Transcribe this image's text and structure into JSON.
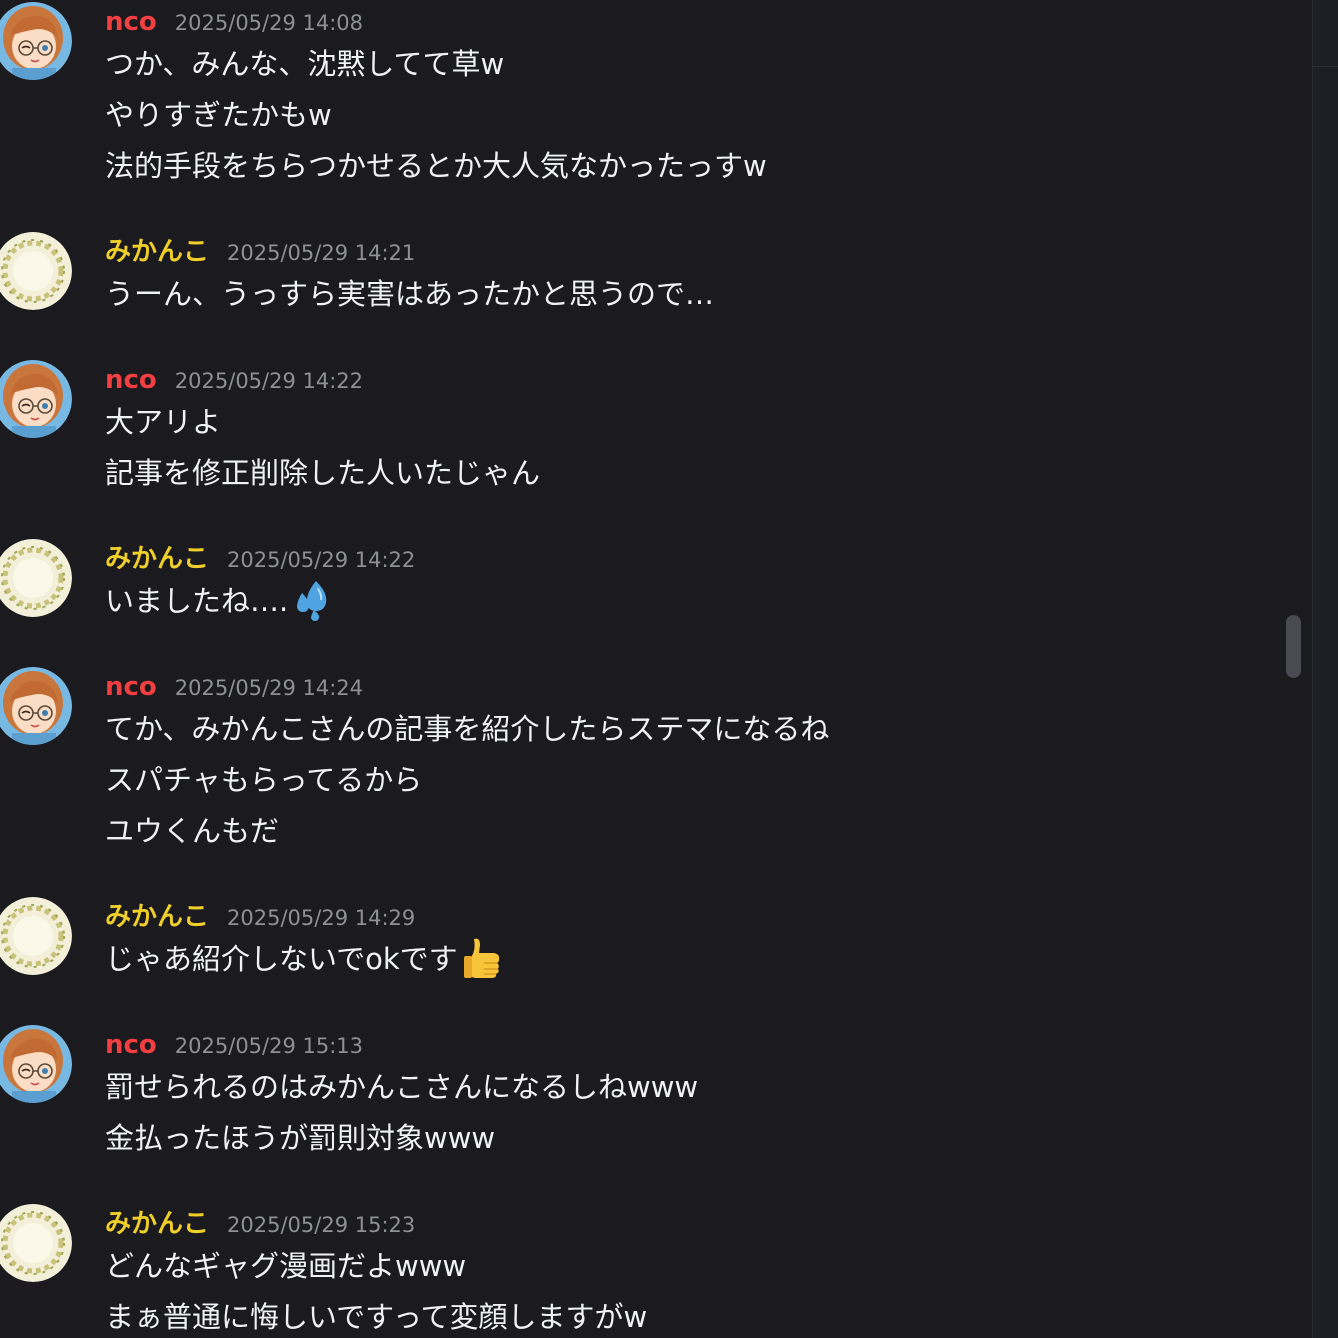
{
  "messages": [
    {
      "author": "nco",
      "time": "2025/05/29 14:08",
      "lines": [
        "つか、みんな、沈黙してて草w",
        "やりすぎたかもw",
        "法的手段をちらつかせるとか大人気なかったっすw"
      ]
    },
    {
      "author": "みかんこ",
      "time": "2025/05/29 14:21",
      "lines": [
        "うーん、うっすら実害はあったかと思うので…"
      ]
    },
    {
      "author": "nco",
      "time": "2025/05/29 14:22",
      "lines": [
        "大アリよ",
        "記事を修正削除した人いたじゃん"
      ]
    },
    {
      "author": "みかんこ",
      "time": "2025/05/29 14:22",
      "lines": [
        "いましたね…."
      ],
      "emoji": "sweat-droplets-icon"
    },
    {
      "author": "nco",
      "time": "2025/05/29 14:24",
      "lines": [
        "てか、みかんこさんの記事を紹介したらステマになるね",
        "スパチャもらってるから",
        "ユウくんもだ"
      ]
    },
    {
      "author": "みかんこ",
      "time": "2025/05/29 14:29",
      "lines": [
        "じゃあ紹介しないでokです"
      ],
      "emoji": "thumbs-up-icon"
    },
    {
      "author": "nco",
      "time": "2025/05/29 15:13",
      "lines": [
        "罰せられるのはみかんこさんになるしねwww",
        "金払ったほうが罰則対象www"
      ]
    },
    {
      "author": "みかんこ",
      "time": "2025/05/29 15:23",
      "lines": [
        "どんなギャグ漫画だよwww",
        "まぁ普通に悔しいですって変顔しますがw"
      ]
    }
  ],
  "colors": {
    "background": "#1a1a1f",
    "nco_name": "#f23f42",
    "mikanko_name": "#f0cf2a",
    "timestamp": "#8e9096",
    "message_text": "#f0f1f3"
  }
}
